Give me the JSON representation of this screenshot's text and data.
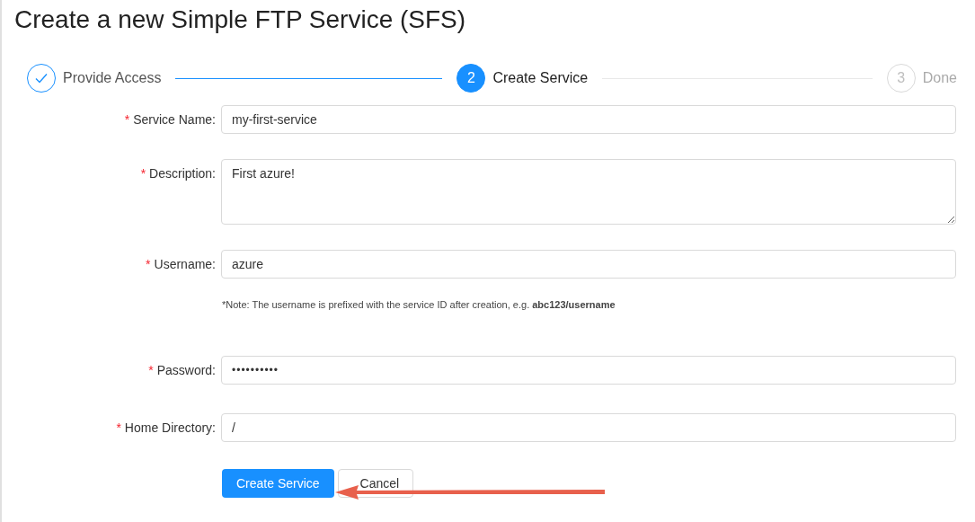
{
  "title": "Create a new Simple FTP Service (SFS)",
  "steps": [
    {
      "label": "Provide Access",
      "kind": "finished"
    },
    {
      "label": "Create Service",
      "number": "2",
      "kind": "process"
    },
    {
      "label": "Done",
      "number": "3",
      "kind": "wait"
    }
  ],
  "fields": [
    {
      "mark": "*",
      "label": "Service Name:",
      "kind": "text",
      "value": "my-first-service"
    },
    {
      "mark": "*",
      "label": "Description:",
      "kind": "textarea",
      "value": "First azure!"
    },
    {
      "mark": "*",
      "label": "Username:",
      "kind": "text",
      "value": "azure",
      "note": "*Note: The username is prefixed with the service ID after creation, e.g. **abc123/username**"
    },
    {
      "mark": "*",
      "label": "Password:",
      "kind": "password",
      "value": "••••••••••"
    },
    {
      "mark": "*",
      "label": "Home Directory:",
      "kind": "text",
      "value": "/"
    }
  ],
  "buttons": [
    {
      "label": "Create Service",
      "kind": "primary"
    },
    {
      "label": "Cancel",
      "kind": "default"
    }
  ]
}
